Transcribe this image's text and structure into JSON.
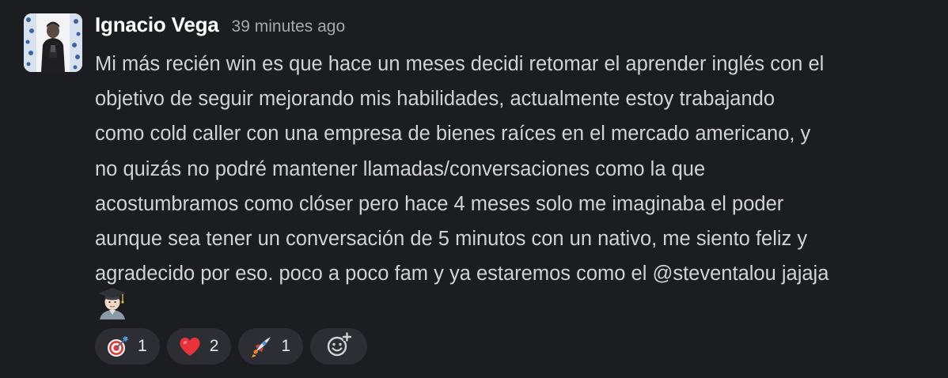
{
  "message": {
    "author": "Ignacio Vega",
    "timestamp": "39 minutes ago",
    "text": "Mi más recién win es que hace un meses decidi retomar el aprender inglés con el\nobjetivo de seguir mejorando mis habilidades, actualmente estoy trabajando\ncomo cold caller con una empresa de bienes raíces en el mercado americano, y\nno quizás no podré mantener llamadas/conversaciones como la que\nacostumbramos como clóser pero hace 4 meses solo me imaginaba el poder\naunque sea tener un conversación de 5 minutos con un nativo, me siento feliz y\nagradecido por eso. poco a poco fam y ya estaremos como el @steventalou jajaja",
    "trailing_emoji": "man-student-emoji"
  },
  "reactions": [
    {
      "emoji": "dart-emoji",
      "count": "1"
    },
    {
      "emoji": "heart-emoji",
      "count": "2"
    },
    {
      "emoji": "rocket-emoji",
      "count": "1"
    }
  ],
  "add_reaction_icon": "add-reaction-icon",
  "colors": {
    "background": "#1b1d21",
    "text": "#d1d2d3",
    "author": "#ffffff",
    "timestamp": "#a7a8ab",
    "reaction_bg": "#2c2e33"
  }
}
